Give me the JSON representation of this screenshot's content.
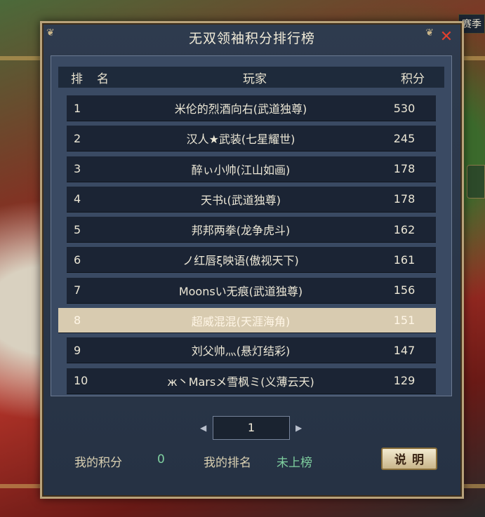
{
  "window": {
    "title": "无双领袖积分排行榜",
    "close_icon": "close-icon",
    "season_tab": "赛季"
  },
  "table": {
    "headers": {
      "rank": "排名",
      "player": "玩家",
      "score": "积分"
    },
    "rows": [
      {
        "rank": "1",
        "player": "米伦的烈酒向右(武道独尊)",
        "score": "530"
      },
      {
        "rank": "2",
        "player": "汉人★武装(七星耀世)",
        "score": "245"
      },
      {
        "rank": "3",
        "player": "醉ぃ小帅(江山如画)",
        "score": "178"
      },
      {
        "rank": "4",
        "player": "天书ι(武道独尊)",
        "score": "178"
      },
      {
        "rank": "5",
        "player": "邦邦两拳(龙争虎斗)",
        "score": "162"
      },
      {
        "rank": "6",
        "player": "ノ红唇ξ映语(傲视天下)",
        "score": "161"
      },
      {
        "rank": "7",
        "player": "Moonsい无痕(武道独尊)",
        "score": "156"
      },
      {
        "rank": "8",
        "player": "超威混混(天涯海角)",
        "score": "151"
      },
      {
        "rank": "9",
        "player": "刘父帅灬(悬灯结彩)",
        "score": "147"
      },
      {
        "rank": "10",
        "player": "ж丶Marsメ雪枫ミ(义薄云天)",
        "score": "129"
      }
    ],
    "highlighted_rank": "8"
  },
  "pager": {
    "page": "1",
    "prev_icon": "caret-left-icon",
    "next_icon": "caret-right-icon"
  },
  "footer": {
    "my_score_label": "我的积分",
    "my_score": "0",
    "my_rank_label": "我的排名",
    "my_rank": "未上榜",
    "explain_button": "说明"
  },
  "colors": {
    "accent": "#7fd0a0",
    "highlight_row": "#d8cbb0",
    "close": "#e0402e"
  }
}
